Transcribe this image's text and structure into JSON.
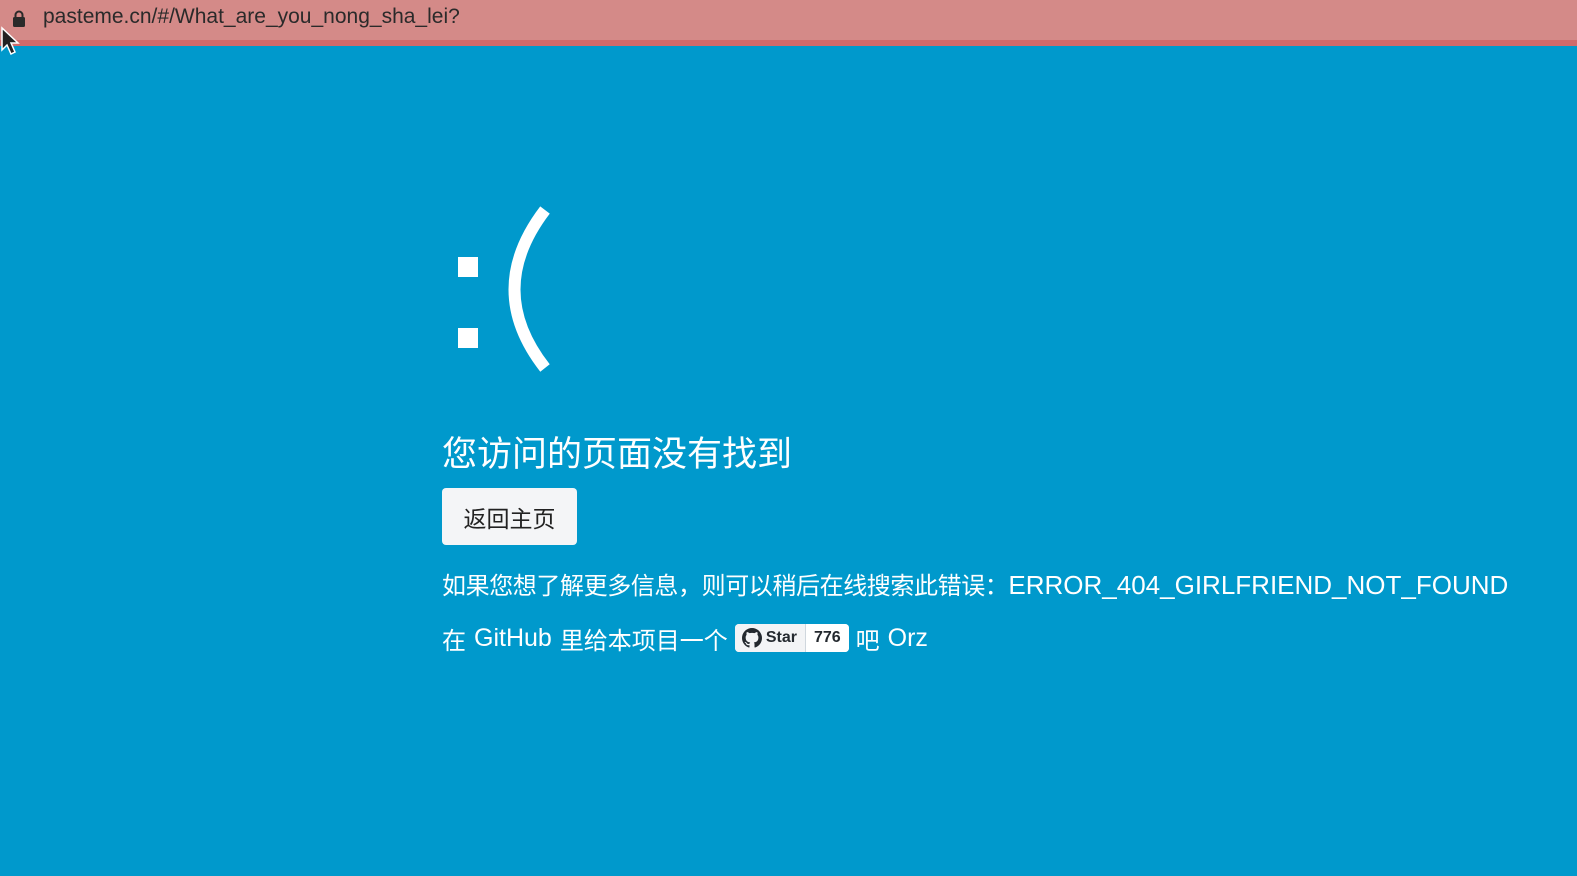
{
  "browser": {
    "url": "pasteme.cn/#/What_are_you_nong_sha_lei?",
    "icons": {
      "lock": "lock-icon",
      "cursor": "mouse-pointer-icon"
    }
  },
  "page": {
    "emoticon": ":(",
    "title": "您访问的页面没有找到",
    "home_button_label": "返回主页",
    "info_prefix": "如果您想了解更多信息，则可以稍后在线搜索此错误：",
    "error_code": "ERROR_404_GIRLFRIEND_NOT_FOUND",
    "star_prefix": "在",
    "star_github": "GitHub",
    "star_middle": "里给本项目一个",
    "star_suffix": "吧",
    "star_orz": "Orz",
    "github_button": {
      "label": "Star",
      "count": "776",
      "icon": "github-icon"
    }
  },
  "colors": {
    "background": "#0099cc",
    "url_bar": "#d48a88",
    "url_bar_border": "#d06a6a",
    "text": "#ffffff"
  }
}
